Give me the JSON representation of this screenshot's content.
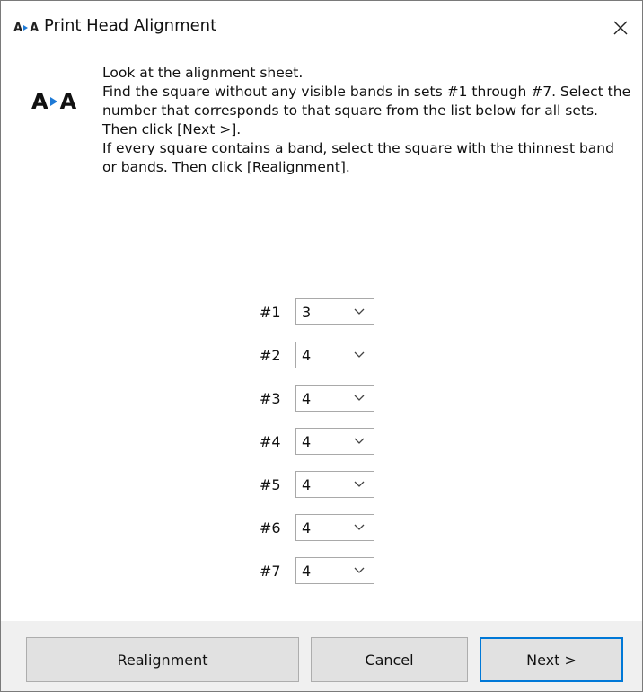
{
  "window": {
    "title": "Print Head Alignment",
    "icon": "align-heads-icon",
    "icon_text_left": "A",
    "icon_text_right": "A"
  },
  "instructions": {
    "line1": "Look at the alignment sheet.",
    "line2": "Find the square without any visible bands in sets #1 through #7. Select the number that corresponds to that square from the list below for all sets. Then click [Next >].",
    "line3": "If every square contains a band, select the square with the thinnest band or bands. Then click [Realignment]."
  },
  "sets": [
    {
      "label": "#1",
      "value": "3"
    },
    {
      "label": "#2",
      "value": "4"
    },
    {
      "label": "#3",
      "value": "4"
    },
    {
      "label": "#4",
      "value": "4"
    },
    {
      "label": "#5",
      "value": "4"
    },
    {
      "label": "#6",
      "value": "4"
    },
    {
      "label": "#7",
      "value": "4"
    }
  ],
  "buttons": {
    "realignment": "Realignment",
    "cancel": "Cancel",
    "next": "Next >"
  },
  "colors": {
    "accent": "#0078d7",
    "arrow": "#1e7ad6"
  }
}
